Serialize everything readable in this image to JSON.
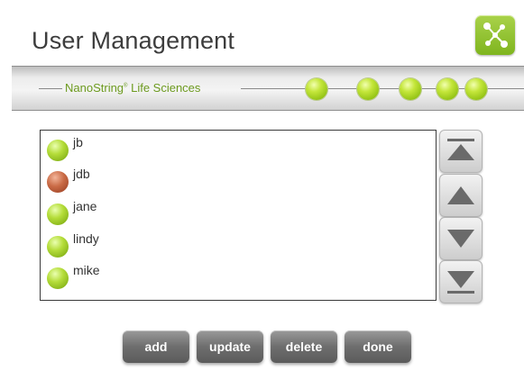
{
  "header": {
    "title": "User Management",
    "logo_icon": "network-nodes-icon",
    "accent_color": "#8cc021"
  },
  "banner": {
    "brand_name": "NanoString",
    "brand_mark": "®",
    "brand_suffix": "Life Sciences",
    "brand_color": "#6c9a1e",
    "step_indicators": 5
  },
  "users": [
    {
      "name": "jb",
      "status": "active"
    },
    {
      "name": "jdb",
      "status": "inactive"
    },
    {
      "name": "jane",
      "status": "active"
    },
    {
      "name": "lindy",
      "status": "active"
    },
    {
      "name": "mike",
      "status": "active"
    }
  ],
  "scroll_controls": [
    {
      "name": "scroll-top-button",
      "icon": "triangle-up-bar-icon"
    },
    {
      "name": "scroll-up-button",
      "icon": "triangle-up-icon"
    },
    {
      "name": "scroll-down-button",
      "icon": "triangle-down-icon"
    },
    {
      "name": "scroll-bottom-button",
      "icon": "triangle-down-bar-icon"
    }
  ],
  "actions": {
    "add": "add",
    "update": "update",
    "delete": "delete",
    "done": "done"
  }
}
